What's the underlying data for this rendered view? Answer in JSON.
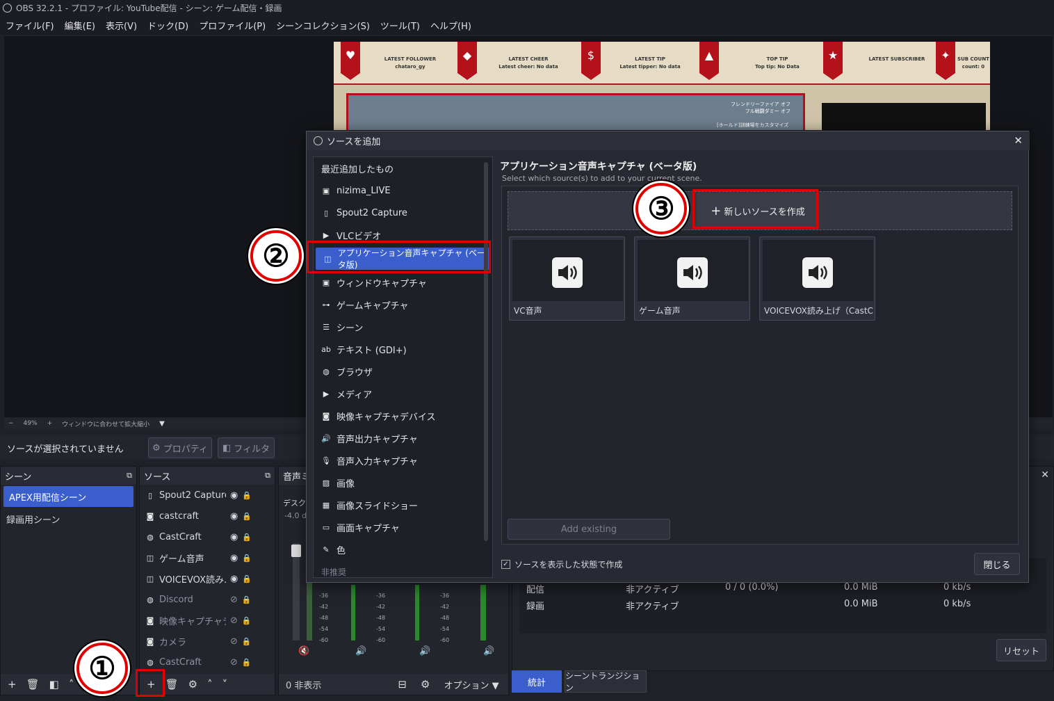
{
  "window": {
    "title": "OBS 32.2.1 - プロファイル: YouTube配信 - シーン: ゲーム配信・録画"
  },
  "menu": [
    "ファイル(F)",
    "編集(E)",
    "表示(V)",
    "ドック(D)",
    "プロファイル(P)",
    "シーンコレクション(S)",
    "ツール(T)",
    "ヘルプ(H)"
  ],
  "overlay": {
    "items": [
      {
        "label": "LATEST FOLLOWER",
        "value": "chataro_gy"
      },
      {
        "label": "LATEST CHEER",
        "value": "Latest cheer: No data"
      },
      {
        "label": "LATEST TIP",
        "value": "Latest tipper: No data"
      },
      {
        "label": "TOP TIP",
        "value": "Top tip: No Data"
      },
      {
        "label": "LATEST SUBSCRIBER",
        "value": ""
      },
      {
        "label": "SUB COUNT",
        "value": "count: 0"
      }
    ],
    "friendly_fire": "フレンドリーファイア",
    "friendly_fire_state": "オフ",
    "dummy": "フル戦闘ダミー",
    "dummy_state": "オフ",
    "customize": "[ホールド]訓練場をカスタマイズ"
  },
  "zoom": {
    "minus": "−",
    "value": "49%",
    "plus": "+",
    "fit": "ウィンドウに合わせて拡大縮小"
  },
  "propbar": {
    "status": "ソースが選択されていません",
    "properties": "プロパティ",
    "filters": "フィルタ"
  },
  "scenes": {
    "title": "シーン",
    "items": [
      "APEX用配信シーン",
      "録画用シーン"
    ]
  },
  "sources": {
    "title": "ソース",
    "items": [
      {
        "name": "Spout2 Capture",
        "icon": "file-icon",
        "visible": true
      },
      {
        "name": "castcraft",
        "icon": "camera-icon",
        "visible": true
      },
      {
        "name": "CastCraft",
        "icon": "globe-icon",
        "visible": true
      },
      {
        "name": "ゲーム音声",
        "icon": "audio-icon",
        "visible": true
      },
      {
        "name": "VOICEVOX読み..",
        "icon": "audio-icon",
        "visible": true
      },
      {
        "name": "Discord",
        "icon": "globe-icon",
        "visible": false
      },
      {
        "name": "映像キャプチャデバ",
        "icon": "camera-icon",
        "visible": false
      },
      {
        "name": "カメラ",
        "icon": "camera-icon",
        "visible": false
      },
      {
        "name": "CastCraft",
        "icon": "globe-icon",
        "visible": false
      }
    ]
  },
  "mixer": {
    "title": "音声ミ",
    "desktop": "デスクト",
    "level": "-4.0 dl",
    "hidden": "0 非表示",
    "options": "オプション",
    "ticks": [
      "-36",
      "-42",
      "-48",
      "-54",
      "-60"
    ]
  },
  "stats": {
    "rows": [
      {
        "name": "配信",
        "state": "非アクティブ",
        "frames": "0 / 0 (0.0%)",
        "size": "0.0 MiB",
        "rate": "0 kb/s"
      },
      {
        "name": "録画",
        "state": "非アクティブ",
        "frames": "",
        "size": "0.0 MiB",
        "rate": "0 kb/s"
      }
    ],
    "reset": "リセット",
    "tab_stats": "統計",
    "tab_transition": "シーントランジション"
  },
  "dialog": {
    "title": "ソースを追加",
    "list": [
      {
        "label": "最近追加したもの",
        "icon": ""
      },
      {
        "label": "nizima_LIVE",
        "icon": "window-icon"
      },
      {
        "label": "Spout2 Capture",
        "icon": "file-icon"
      },
      {
        "label": "VLCビデオ",
        "icon": "play-icon"
      },
      {
        "label": "アプリケーション音声キャプチャ (ベータ版)",
        "icon": "app-audio-icon",
        "selected": true
      },
      {
        "label": "ウィンドウキャプチャ",
        "icon": "window-icon"
      },
      {
        "label": "ゲームキャプチャ",
        "icon": "gamepad-icon"
      },
      {
        "label": "シーン",
        "icon": "list-icon"
      },
      {
        "label": "テキスト (GDI+)",
        "icon": "text-icon"
      },
      {
        "label": "ブラウザ",
        "icon": "globe-icon"
      },
      {
        "label": "メディア",
        "icon": "play-icon"
      },
      {
        "label": "映像キャプチャデバイス",
        "icon": "camera-icon"
      },
      {
        "label": "音声出力キャプチャ",
        "icon": "speaker-icon"
      },
      {
        "label": "音声入力キャプチャ",
        "icon": "mic-icon"
      },
      {
        "label": "画像",
        "icon": "image-icon"
      },
      {
        "label": "画像スライドショー",
        "icon": "slideshow-icon"
      },
      {
        "label": "画面キャプチャ",
        "icon": "monitor-icon"
      },
      {
        "label": "色",
        "icon": "brush-icon"
      },
      {
        "label": "非推奨",
        "icon": ""
      }
    ],
    "heading": "アプリケーション音声キャプチャ (ベータ版)",
    "subheading": "Select which source(s) to add to your current scene.",
    "new_source": "新しいソースを作成",
    "existing": [
      "VC音声",
      "ゲーム音声",
      "VOICEVOX読み上げ（CastC"
    ],
    "add_existing": "Add existing",
    "visible_check": "ソースを表示した状態で作成",
    "close": "閉じる"
  },
  "markers": [
    "①",
    "②",
    "③"
  ]
}
